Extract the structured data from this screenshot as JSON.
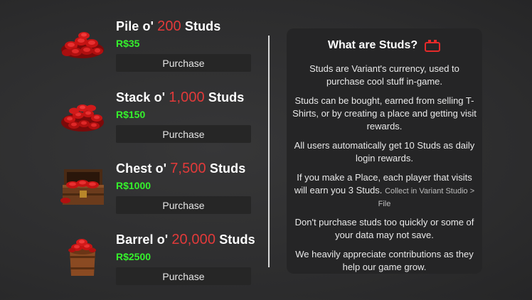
{
  "offers": [
    {
      "prefix": "Pile o' ",
      "amount": "200",
      "suffix": " Studs",
      "price": "R$35",
      "button_label": "Purchase",
      "icon": "studs-pile-icon"
    },
    {
      "prefix": "Stack o' ",
      "amount": "1,000",
      "suffix": " Studs",
      "price": "R$150",
      "button_label": "Purchase",
      "icon": "studs-stack-icon"
    },
    {
      "prefix": "Chest o' ",
      "amount": "7,500",
      "suffix": " Studs",
      "price": "R$1000",
      "button_label": "Purchase",
      "icon": "treasure-chest-icon"
    },
    {
      "prefix": "Barrel o' ",
      "amount": "20,000",
      "suffix": " Studs",
      "price": "R$2500",
      "button_label": "Purchase",
      "icon": "studs-barrel-icon"
    }
  ],
  "info": {
    "title": "What are Studs?",
    "title_icon": "stud-brick-icon",
    "paragraphs": [
      "Studs are Variant's currency, used to purchase cool stuff in-game.",
      "Studs can be bought, earned from selling T-Shirts, or by creating a place and getting visit rewards.",
      "All users automatically get 10 Studs as daily login rewards.",
      "If you make a Place, each player that visits will earn you 3 Studs."
    ],
    "paragraph4_note": "Collect in Variant Studio > File",
    "paragraphs_after": [
      "Don't purchase studs too quickly or some of your data may not save.",
      "We heavily appreciate contributions as they help our game grow."
    ]
  },
  "colors": {
    "amount": "#e23a3a",
    "price": "#35f22c",
    "button_bg": "#262626",
    "panel_bg": "#252526",
    "icon_red": "#e42a2a"
  }
}
